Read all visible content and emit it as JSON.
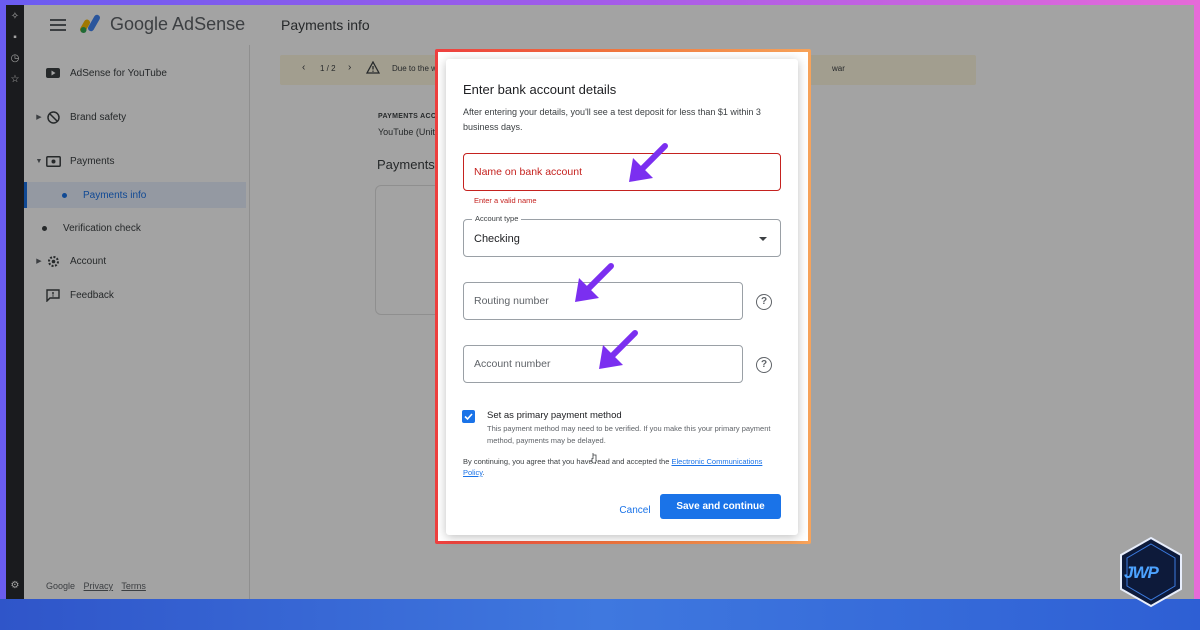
{
  "app": {
    "logo_text": "Google AdSense",
    "page_title": "Payments info"
  },
  "sidebar": {
    "items": [
      {
        "label": "AdSense for YouTube",
        "icon": "youtube-icon"
      },
      {
        "label": "Brand safety",
        "icon": "block-icon"
      },
      {
        "label": "Payments",
        "icon": "payments-icon"
      },
      {
        "label": "Payments info",
        "icon": "dot-icon",
        "active": true
      },
      {
        "label": "Verification check",
        "icon": "dot-icon"
      },
      {
        "label": "Account",
        "icon": "gear-icon"
      },
      {
        "label": "Feedback",
        "icon": "feedback-icon"
      }
    ],
    "footer": {
      "google": "Google",
      "privacy": "Privacy",
      "terms": "Terms"
    }
  },
  "main": {
    "banner": {
      "pager": "1 / 2",
      "text_start": "Due to the w",
      "text_end": "war"
    },
    "payments_account_label": "PAYMENTS ACCO",
    "payments_account_sub": "YouTube (Unit",
    "payments_heading": "Payments"
  },
  "dialog": {
    "title": "Enter bank account details",
    "description": "After entering your details, you'll see a test deposit for less than $1 within 3 business days.",
    "name_field": {
      "placeholder": "Name on bank account",
      "error": "Enter a valid name"
    },
    "account_type": {
      "label": "Account type",
      "value": "Checking"
    },
    "routing_field": {
      "placeholder": "Routing number"
    },
    "account_field": {
      "placeholder": "Account number"
    },
    "primary_checkbox": {
      "checked": true,
      "label": "Set as primary payment method",
      "description": "This payment method may need to be verified. If you make this your primary payment method, payments may be delayed."
    },
    "terms_prefix": "By continuing, you agree that you have read and accepted the",
    "terms_link": "Electronic Communications Policy",
    "terms_suffix": ".",
    "cancel_label": "Cancel",
    "save_label": "Save and continue"
  },
  "colors": {
    "accent": "#1a73e8",
    "error": "#c5221f",
    "annotation_arrow": "#7b2ff0",
    "highlight_border_start": "#ee3f3f",
    "highlight_border_end": "#f7a35a"
  },
  "watermark": {
    "text": "JWP"
  }
}
